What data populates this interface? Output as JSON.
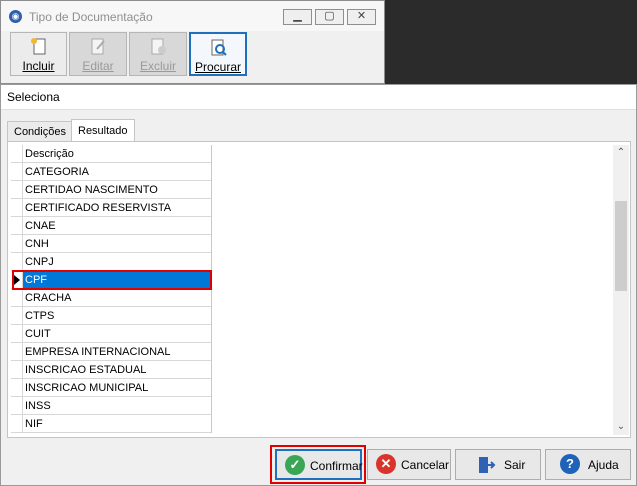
{
  "main_window": {
    "title": "Tipo de Documentação",
    "toolbar": [
      {
        "label": "Incluir",
        "icon": "new-document-icon",
        "state": "enabled"
      },
      {
        "label": "Editar",
        "icon": "edit-document-icon",
        "state": "disabled"
      },
      {
        "label": "Excluir",
        "icon": "delete-document-icon",
        "state": "disabled"
      },
      {
        "label": "Procurar",
        "icon": "search-document-icon",
        "state": "active"
      }
    ]
  },
  "dialog": {
    "title": "Seleciona",
    "tabs": [
      "Condições",
      "Resultado"
    ],
    "active_tab": "Resultado",
    "grid": {
      "column_header": "Descrição",
      "rows": [
        "CATEGORIA",
        "CERTIDAO NASCIMENTO",
        "CERTIFICADO RESERVISTA",
        "CNAE",
        "CNH",
        "CNPJ",
        "CPF",
        "CRACHA",
        "CTPS",
        "CUIT",
        "EMPRESA INTERNACIONAL",
        "INSCRICAO ESTADUAL",
        "INSCRICAO MUNICIPAL",
        "INSS",
        "NIF"
      ],
      "selected_row": "CPF"
    },
    "buttons": {
      "confirm": "Confirmar",
      "cancel": "Cancelar",
      "exit": "Sair",
      "help": "Ajuda"
    }
  },
  "colors": {
    "selection": "#0078d7",
    "highlight_border": "#e00000",
    "confirm_icon": "#3aa655",
    "cancel_icon": "#d9342b",
    "help_icon": "#1f63b8"
  }
}
